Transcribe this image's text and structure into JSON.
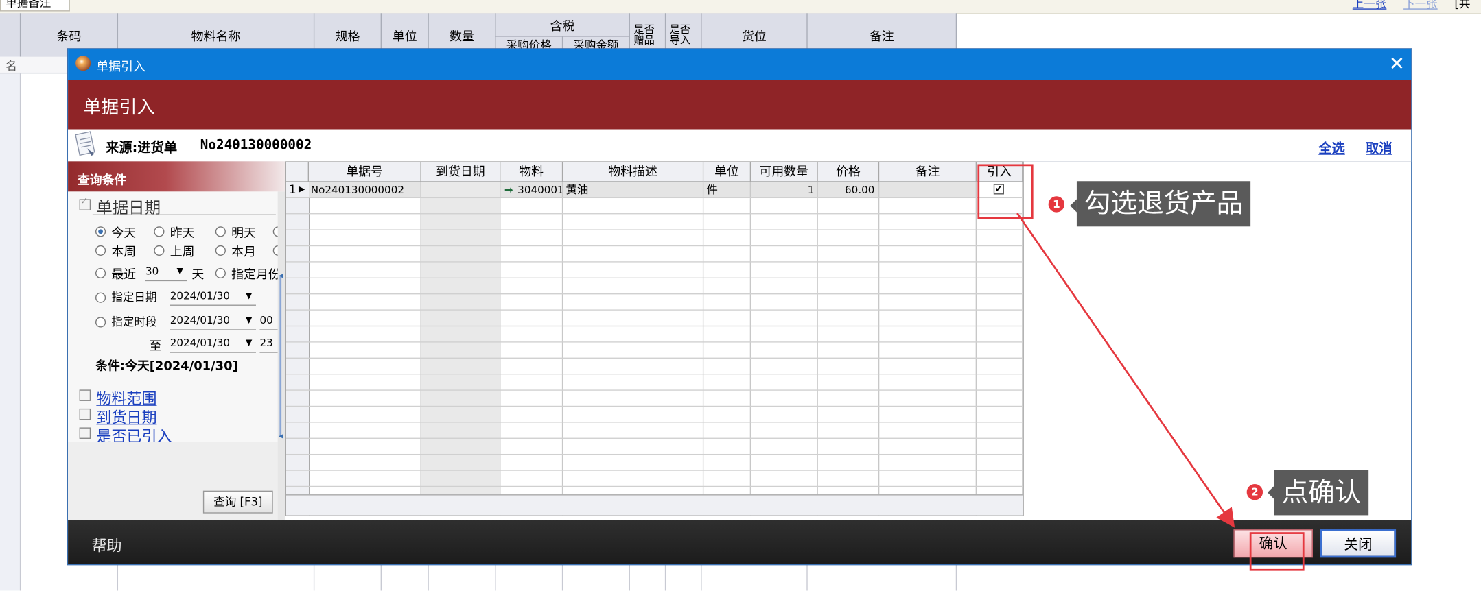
{
  "background": {
    "tab_label": "单据备注",
    "prev_link": "上一张",
    "next_link": "下一张",
    "corner_text": "[共",
    "side_label": "名",
    "columns": [
      "条码",
      "物料名称",
      "规格",
      "单位",
      "数量",
      "含税",
      "是否赠品",
      "是否导入",
      "货位",
      "备注"
    ],
    "tax_subcolumns": [
      "采购价格",
      "采购金额"
    ]
  },
  "dialog": {
    "window_title": "单据引入",
    "banner_title": "单据引入",
    "source_label": "来源:进货单",
    "source_number": "No240130000002",
    "select_all": "全选",
    "cancel": "取消",
    "query": {
      "header": "查询条件",
      "doc_date_label": "单据日期",
      "radios_row1": [
        "今天",
        "昨天",
        "明天"
      ],
      "radios_row2": [
        "本周",
        "上周",
        "本月"
      ],
      "recent_label": "最近",
      "recent_value": "30",
      "recent_unit": "天",
      "specified_month": "指定月份",
      "specified_date_label": "指定日期",
      "specified_date_value": "2024/01/30",
      "specified_range_label": "指定时段",
      "range_from": "2024/01/30",
      "range_from_time": "00",
      "range_to_label": "至",
      "range_to": "2024/01/30",
      "range_to_time": "23",
      "condition_text": "条件:今天[2024/01/30]",
      "filters": [
        "物料范围",
        "到货日期",
        "是否已引入"
      ],
      "query_button": "查询 [F3]"
    },
    "grid": {
      "columns": [
        "单据号",
        "到货日期",
        "物料",
        "物料描述",
        "单位",
        "可用数量",
        "价格",
        "备注",
        "引入"
      ],
      "rows": [
        {
          "num": "1",
          "doc_no": "No240130000002",
          "arrival": "",
          "material": "3040001",
          "desc": "黄油",
          "unit": "件",
          "qty": "1",
          "price": "60.00",
          "note": "",
          "import_checked": true
        }
      ]
    },
    "help": "帮助",
    "confirm_button": "确认",
    "close_button": "关闭"
  },
  "annotations": {
    "step1_num": "1",
    "step1_text": "勾选退货产品",
    "step2_num": "2",
    "step2_text": "点确认"
  },
  "colors": {
    "titlebar": "#0c7bd8",
    "banner": "#8f2427",
    "annotation_red": "#e5383f",
    "callout_bg": "#5a5a5a"
  }
}
